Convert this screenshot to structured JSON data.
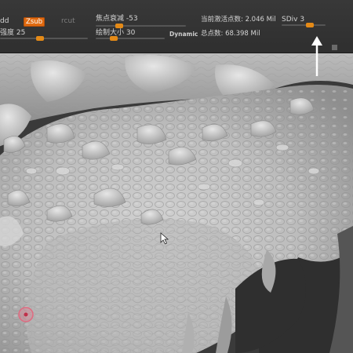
{
  "toolbar": {
    "draw_label": "dd",
    "zsub_button": "Zsub",
    "zsub_neighbor": "rcut",
    "intensity_label": "强度 25",
    "intensity_value": 25,
    "focal_shift_label": "焦点衰减 -53",
    "focal_shift_value": -53,
    "draw_size_label": "绘制大小 30",
    "draw_size_value": 30,
    "dynamic_label": "Dynamic",
    "active_points_label": "当前激活点数: 2.046 Mil",
    "total_points_label": "总点数: 68.398 Mil",
    "sdiv_label": "SDiv 3",
    "sdiv_value": 3
  },
  "colors": {
    "accent": "#e06a10",
    "toolbar_bg": "#333333",
    "sculpt_surface": "#c8c8c8",
    "background": "#2a2a2a"
  },
  "icons": {
    "pointer": "mouse-cursor-icon",
    "annotation": "arrow-up-icon",
    "brush": "brush-circle-icon"
  }
}
